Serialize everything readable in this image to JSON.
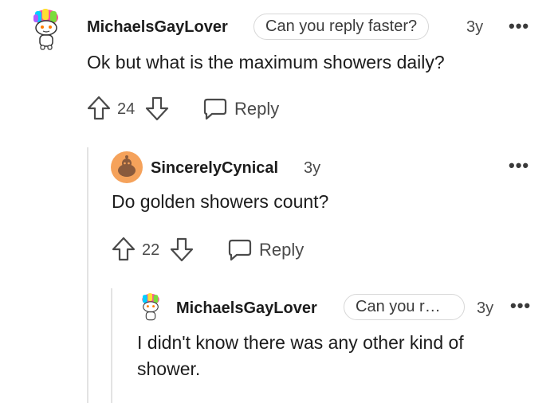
{
  "comments": [
    {
      "username": "MichaelsGayLover",
      "flair": "Can you reply faster?",
      "age": "3y",
      "more": "•••",
      "body": "Ok but what is the maximum showers daily?",
      "votes": "24",
      "reply_label": "Reply"
    },
    {
      "username": "SincerelyCynical",
      "age": "3y",
      "more": "•••",
      "body": "Do golden showers count?",
      "votes": "22",
      "reply_label": "Reply"
    },
    {
      "username": "MichaelsGayLover",
      "flair": "Can you r…",
      "age": "3y",
      "more": "•••",
      "body_line1": "I didn't know there was any other kind of",
      "body_line2": "shower."
    }
  ],
  "colors": {
    "text": "#1c1c1c",
    "muted": "#4a4a4a",
    "thread_line": "#e3e3e3",
    "avatar_orange": "#f5a25b"
  },
  "icons": [
    "avatar-icon",
    "upvote-icon",
    "downvote-icon",
    "reply-icon",
    "more-options-icon"
  ]
}
